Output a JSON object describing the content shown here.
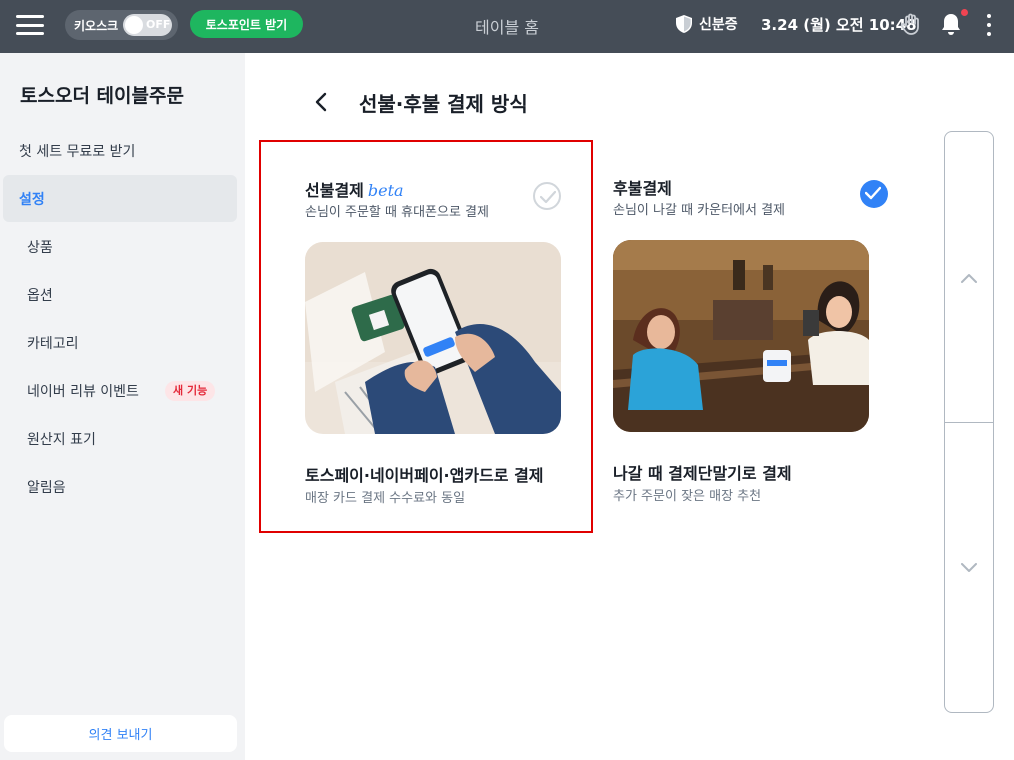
{
  "topbar": {
    "kiosk_label": "키오스크",
    "kiosk_toggle": "OFF",
    "points_button": "토스포인트 받기",
    "title": "테이블 홈",
    "certification": "신분증",
    "datetime": "3.24 (월) 오전 10:48",
    "bg_color": "#454d57",
    "points_color": "#1eb65f"
  },
  "sidebar": {
    "title": "토스오더 테이블주문",
    "items": [
      {
        "label": "첫 세트 무료로 받기"
      },
      {
        "label": "설정"
      },
      {
        "label": "상품"
      },
      {
        "label": "옵션"
      },
      {
        "label": "카테고리"
      },
      {
        "label": "네이버 리뷰 이벤트",
        "badge": "새 기능"
      },
      {
        "label": "원산지 표기"
      },
      {
        "label": "알림음"
      }
    ],
    "feedback_button": "의견 보내기"
  },
  "main": {
    "page_title": "선불·후불 결제 방식",
    "options": [
      {
        "title": "선불결제",
        "tag": "beta",
        "subtitle": "손님이 주문할 때 휴대폰으로 결제",
        "selected": false,
        "main_text": "토스페이·네이버페이·앱카드로 결제",
        "desc": "매장 카드 결제 수수료와 동일"
      },
      {
        "title": "후불결제",
        "subtitle": "손님이 나갈 때 카운터에서 결제",
        "selected": true,
        "main_text": "나갈 때 결제단말기로 결제",
        "desc": "추가 주문이 잦은 매장 추천"
      }
    ],
    "accent_color": "#3182f6",
    "highlight_color": "#e00000"
  }
}
